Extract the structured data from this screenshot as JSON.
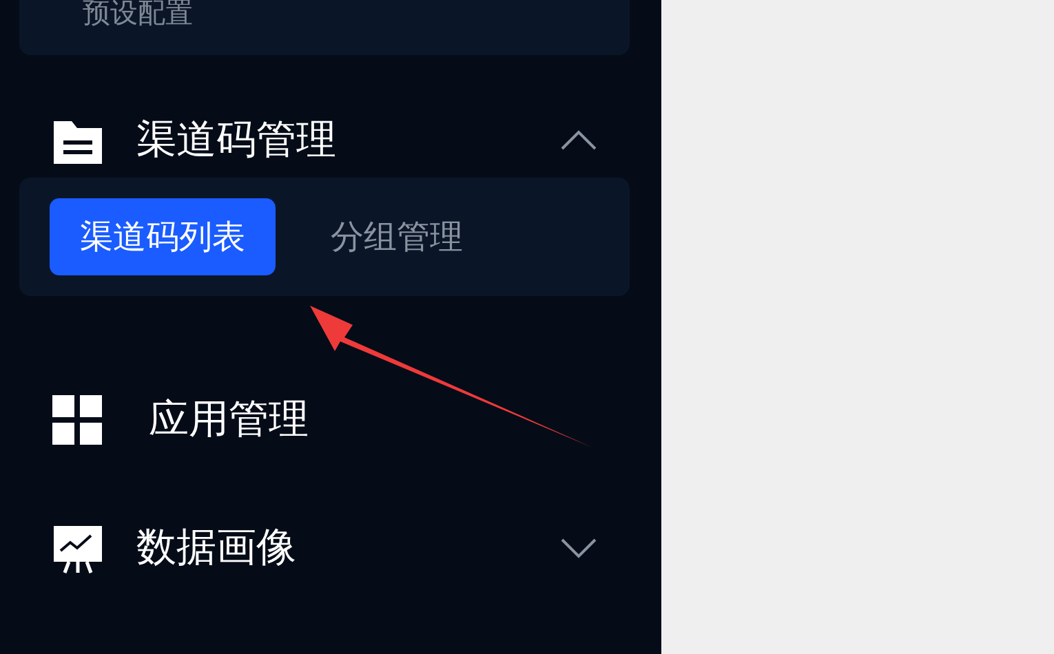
{
  "sidebar": {
    "top_panel": {
      "label": "预设配置"
    },
    "items": [
      {
        "kind": "group",
        "label": "渠道码管理",
        "expanded": true,
        "children": [
          {
            "label": "渠道码列表",
            "selected": true
          },
          {
            "label": "分组管理",
            "selected": false
          }
        ]
      },
      {
        "kind": "link",
        "label": "应用管理"
      },
      {
        "kind": "group",
        "label": "数据画像",
        "expanded": false
      }
    ]
  }
}
